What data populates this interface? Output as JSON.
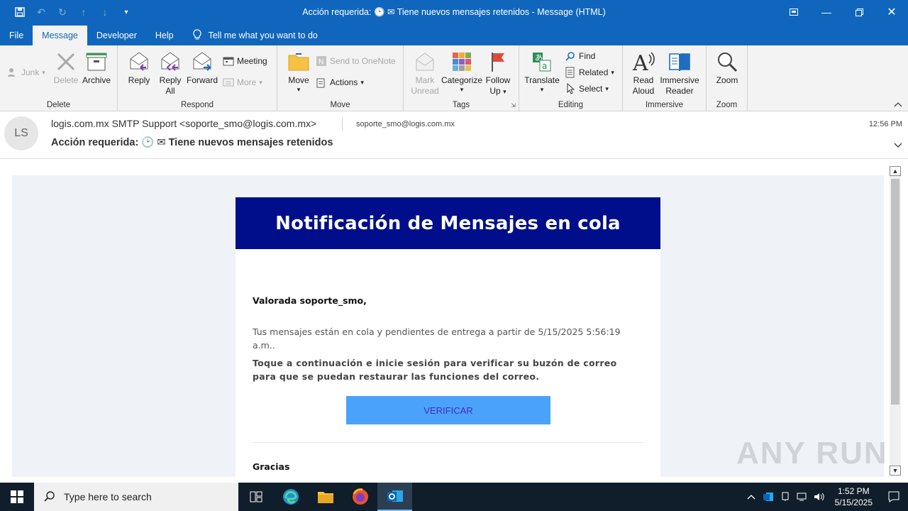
{
  "window": {
    "title": "Acción requerida: 🕑 ✉ Tiene nuevos mensajes retenidos  -  Message (HTML)"
  },
  "menu": {
    "tabs": [
      "File",
      "Message",
      "Developer",
      "Help"
    ],
    "active_tab": "Message",
    "tell_me": "Tell me what you want to do"
  },
  "ribbon": {
    "delete_group": {
      "label": "Delete",
      "junk": "Junk",
      "delete": "Delete",
      "archive": "Archive"
    },
    "respond_group": {
      "label": "Respond",
      "reply": "Reply",
      "reply_all_1": "Reply",
      "reply_all_2": "All",
      "forward": "Forward",
      "meeting": "Meeting",
      "more": "More"
    },
    "move_group": {
      "label": "Move",
      "move": "Move",
      "send_onenote": "Send to OneNote",
      "actions": "Actions"
    },
    "tags_group": {
      "label": "Tags",
      "mark_1": "Mark",
      "mark_2": "Unread",
      "categorize": "Categorize",
      "follow_1": "Follow",
      "follow_2": "Up"
    },
    "editing_group": {
      "label": "Editing",
      "translate": "Translate",
      "find": "Find",
      "related": "Related",
      "select": "Select"
    },
    "immersive_group": {
      "label": "Immersive",
      "read_1": "Read",
      "read_2": "Aloud",
      "imm_1": "Immersive",
      "imm_2": "Reader"
    },
    "zoom_group": {
      "label": "Zoom",
      "zoom": "Zoom"
    }
  },
  "message": {
    "avatar_initials": "LS",
    "sender": "logis.com.mx SMTP Support <soporte_smo@logis.com.mx>",
    "to": "soporte_smo@logis.com.mx",
    "time": "12:56 PM",
    "subject": "Acción requerida: 🕑 ✉ Tiene nuevos mensajes retenidos"
  },
  "email_body": {
    "banner": "Notificación de Mensajes en cola",
    "greeting": "Valorada soporte_smo,",
    "line1": "Tus mensajes están en cola y pendientes de entrega a partir de 5/15/2025 5:56:19 a.m..",
    "line2": "Toque a continuación  e inicie sesión para verificar su buzón de correo  para que se puedan restaurar  las funciones  del correo.",
    "button": "VERIFICAR",
    "thanks": "Gracias"
  },
  "watermark": "ANY RUN",
  "taskbar": {
    "search_placeholder": "Type here to search",
    "time": "1:52 PM",
    "date": "5/15/2025"
  },
  "colors": {
    "accent": "#1066bd",
    "banner": "#000e8b",
    "button": "#4aa2fa"
  }
}
